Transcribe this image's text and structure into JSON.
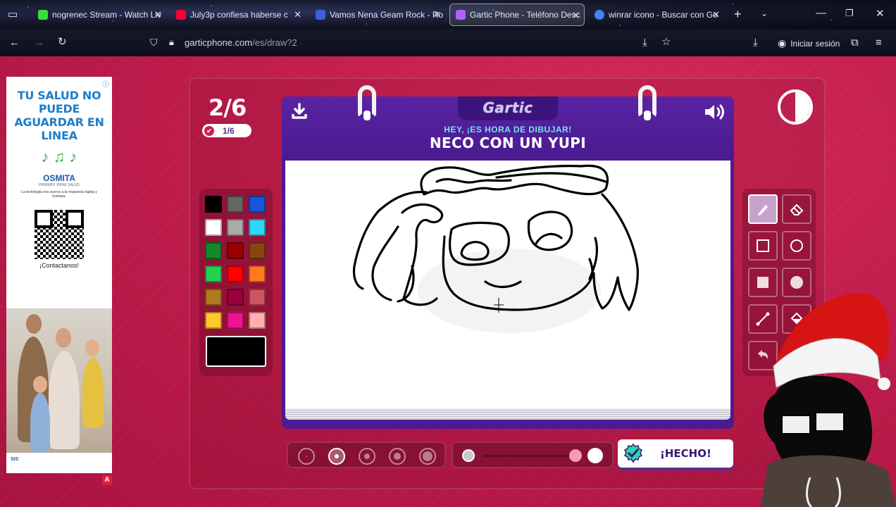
{
  "browser": {
    "tabs": [
      {
        "label": "nogrenec Stream - Watch Liv",
        "favicon_color": "#3ddc3d"
      },
      {
        "label": "July3p confiesa haberse c",
        "favicon_color": "#ff0033"
      },
      {
        "label": "Vamos Nena Geam Rock - Ro",
        "favicon_color": "#3a62d8"
      },
      {
        "label": "Gartic Phone - Teléfono Desc",
        "favicon_color": "#b060ff"
      },
      {
        "label": "winrar icono - Buscar con Go",
        "favicon_color": "#4285f4"
      }
    ],
    "address": {
      "domain": "garticphone.com",
      "path": "/es/draw?2"
    },
    "login_label": "Iniciar sesión"
  },
  "ad": {
    "headline": "TU SALUD NO PUEDE AGUARDAR EN LINEA",
    "brand": "OSMITA",
    "brand_sub": "PRIMERO VIENE SALUD",
    "blurb": "La tecnología nos acerca a la respuesta rápida y humana.",
    "contact": "¡Contactanos!",
    "footer_code": "SIS",
    "badge": "A"
  },
  "game": {
    "round": "2/6",
    "round_badge": "1/6",
    "logo": "Gartic",
    "prompt_sub": "HEY, ¡ES HORA DE DIBUJAR!",
    "prompt_main": "NECO CON UN YUPI",
    "done_label": "¡HECHO!"
  },
  "palette": {
    "colors": [
      "#000000",
      "#666666",
      "#1a55d6",
      "#ffffff",
      "#aaaaaa",
      "#2ed6f7",
      "#128a2c",
      "#990000",
      "#8b4513",
      "#22d352",
      "#ff0000",
      "#ff7a1e",
      "#b07b1e",
      "#99003d",
      "#cc5560",
      "#ffc82c",
      "#ee1491",
      "#ffb0b0"
    ],
    "current": "#000000"
  },
  "tools": [
    "pen",
    "eraser",
    "rect-outline",
    "ellipse-outline",
    "rect-filled",
    "ellipse-filled",
    "line",
    "fill-bucket",
    "undo"
  ],
  "brush_sizes": {
    "count": 5,
    "selected_index": 1
  },
  "opacity": {
    "value": 1.0
  }
}
